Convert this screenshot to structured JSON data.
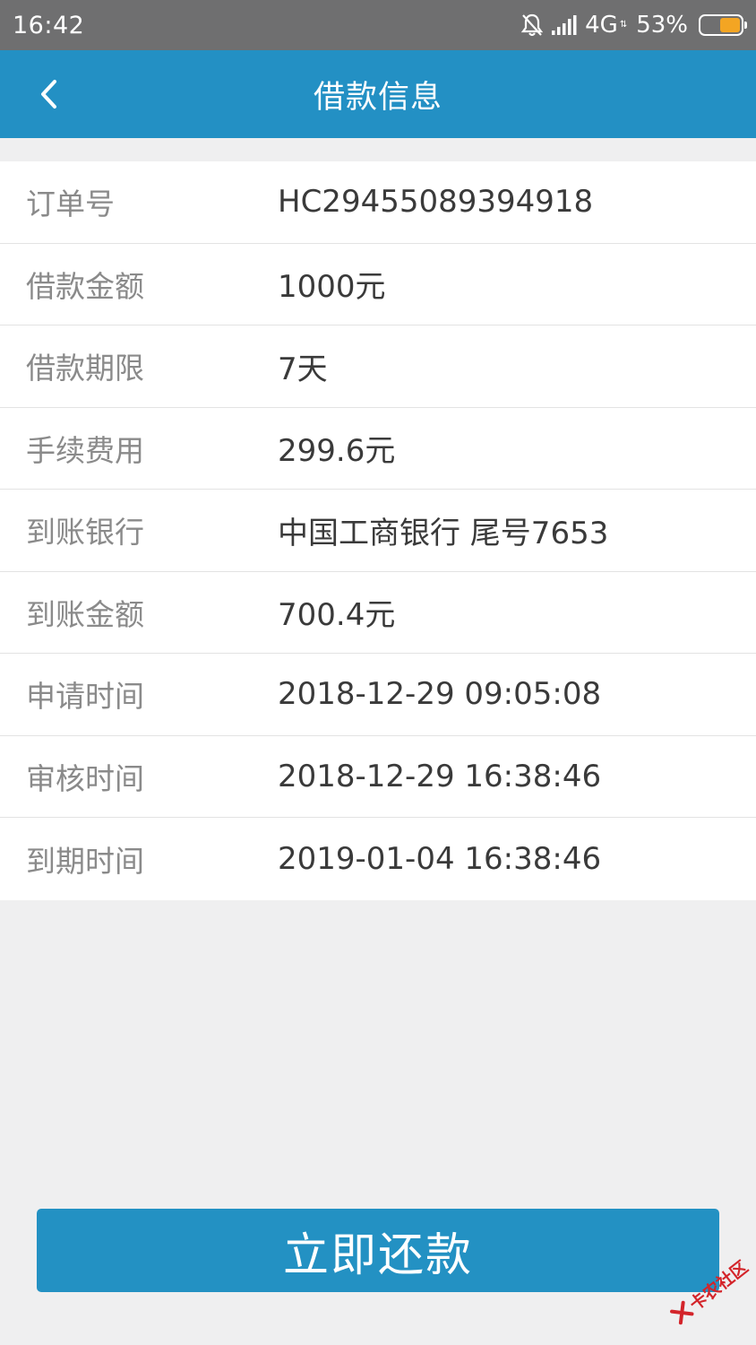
{
  "status_bar": {
    "time": "16:42",
    "network": "4G",
    "battery_percent": "53%",
    "battery_level": 0.53,
    "icons": [
      "bell-muted-icon",
      "signal-icon",
      "battery-icon"
    ]
  },
  "header": {
    "title": "借款信息",
    "back_icon": "chevron-left-icon"
  },
  "info": {
    "rows": [
      {
        "label": "订单号",
        "value": "HC29455089394918"
      },
      {
        "label": "借款金额",
        "value": "1000元"
      },
      {
        "label": "借款期限",
        "value": "7天"
      },
      {
        "label": "手续费用",
        "value": "299.6元"
      },
      {
        "label": "到账银行",
        "value": "中国工商银行 尾号7653"
      },
      {
        "label": "到账金额",
        "value": "700.4元"
      },
      {
        "label": "申请时间",
        "value": "2018-12-29 09:05:08"
      },
      {
        "label": "审核时间",
        "value": "2018-12-29 16:38:46"
      },
      {
        "label": "到期时间",
        "value": "2019-01-04 16:38:46"
      }
    ]
  },
  "actions": {
    "repay_label": "立即还款"
  },
  "watermark": {
    "text": "卡农社区"
  },
  "colors": {
    "header_bg": "#2390c4",
    "button_bg": "#2391c3",
    "status_bar_bg": "#6f6f70",
    "battery_fill": "#f3a523",
    "watermark_red": "#d3242a"
  }
}
